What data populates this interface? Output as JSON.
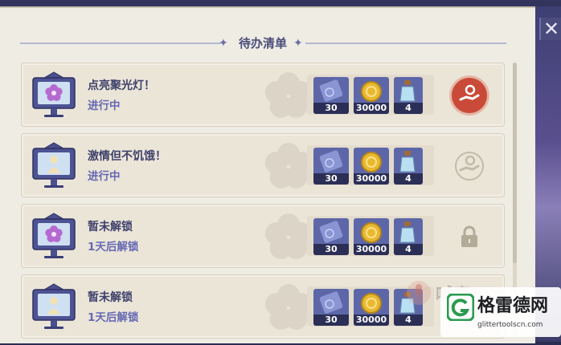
{
  "header": {
    "title": "待办清单",
    "left_ornament": "✦",
    "right_ornament": "✦"
  },
  "close_glyph": "✕",
  "tasks": [
    {
      "name": "点亮聚光灯！",
      "status": "进行中",
      "board_icon": "flower-icon",
      "rewards": [
        {
          "icon": "ticket-icon",
          "count": "30"
        },
        {
          "icon": "coin-icon",
          "count": "30000"
        },
        {
          "icon": "potion-icon",
          "count": "4"
        }
      ],
      "action": "claim",
      "action_icon": "hand-reward-icon"
    },
    {
      "name": "激情但不饥饿！",
      "status": "进行中",
      "board_icon": "figure-icon",
      "rewards": [
        {
          "icon": "ticket-icon",
          "count": "30"
        },
        {
          "icon": "coin-icon",
          "count": "30000"
        },
        {
          "icon": "potion-icon",
          "count": "4"
        }
      ],
      "action": "claim-disabled",
      "action_icon": "hand-reward-icon"
    },
    {
      "name": "暂未解锁",
      "status": "1天后解锁",
      "board_icon": "flower-icon",
      "rewards": [
        {
          "icon": "ticket-icon",
          "count": "30"
        },
        {
          "icon": "coin-icon",
          "count": "30000"
        },
        {
          "icon": "potion-icon",
          "count": "4"
        }
      ],
      "action": "locked",
      "action_icon": "lock-icon"
    },
    {
      "name": "暂未解锁",
      "status": "1天后解锁",
      "board_icon": "figure-icon",
      "rewards": [
        {
          "icon": "ticket-icon",
          "count": "30"
        },
        {
          "icon": "coin-icon",
          "count": "30000"
        },
        {
          "icon": "potion-icon",
          "count": "4"
        }
      ],
      "action": "locked",
      "action_icon": "lock-icon"
    }
  ],
  "watermark": {
    "title": "格雷德网",
    "url": "glittertoolscn.com",
    "mid_text": "喊麦"
  },
  "colors": {
    "accent_claim": "#c94a38",
    "status_text": "#6568b3",
    "title_text": "#3f416b",
    "reward_bg": "#5d67a8"
  }
}
